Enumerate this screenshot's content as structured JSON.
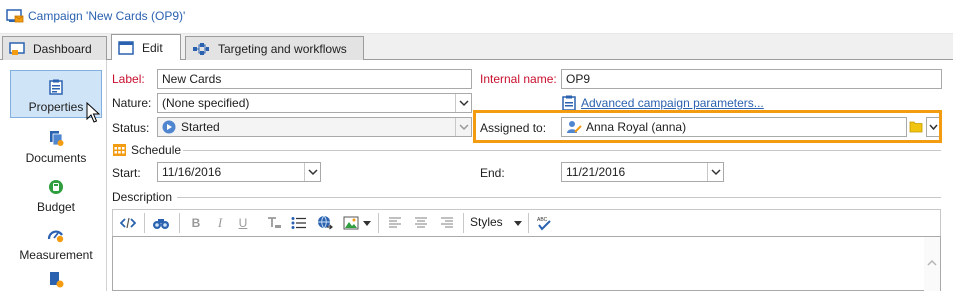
{
  "window": {
    "title": "Campaign 'New Cards (OP9)'"
  },
  "tabs": [
    {
      "label": "Dashboard",
      "icon": "dashboard-icon"
    },
    {
      "label": "Edit",
      "icon": "edit-icon"
    },
    {
      "label": "Targeting and workflows",
      "icon": "workflow-icon"
    }
  ],
  "active_tab": "Edit",
  "sidebar": {
    "items": [
      {
        "label": "Properties",
        "icon": "clipboard-icon",
        "active": true
      },
      {
        "label": "Documents",
        "icon": "documents-icon"
      },
      {
        "label": "Budget",
        "icon": "budget-icon"
      },
      {
        "label": "Measurement",
        "icon": "measurement-icon"
      }
    ]
  },
  "form": {
    "label_caption": "Label:",
    "label_value": "New Cards",
    "internal_name_caption": "Internal name:",
    "internal_name_value": "OP9",
    "nature_caption": "Nature:",
    "nature_value": "(None specified)",
    "advanced_link": "Advanced campaign parameters...",
    "status_caption": "Status:",
    "status_value": "Started",
    "assigned_caption": "Assigned to:",
    "assigned_value": "Anna Royal (anna)",
    "schedule_caption": "Schedule",
    "start_caption": "Start:",
    "start_value": "11/16/2016",
    "end_caption": "End:",
    "end_value": "11/21/2016",
    "description_caption": "Description"
  },
  "editor_toolbar": {
    "styles_label": "Styles"
  },
  "colors": {
    "highlight": "#f39c12",
    "link": "#2b62b0",
    "required_label": "#c8102e",
    "active_side_item": "#cfe4f7"
  }
}
